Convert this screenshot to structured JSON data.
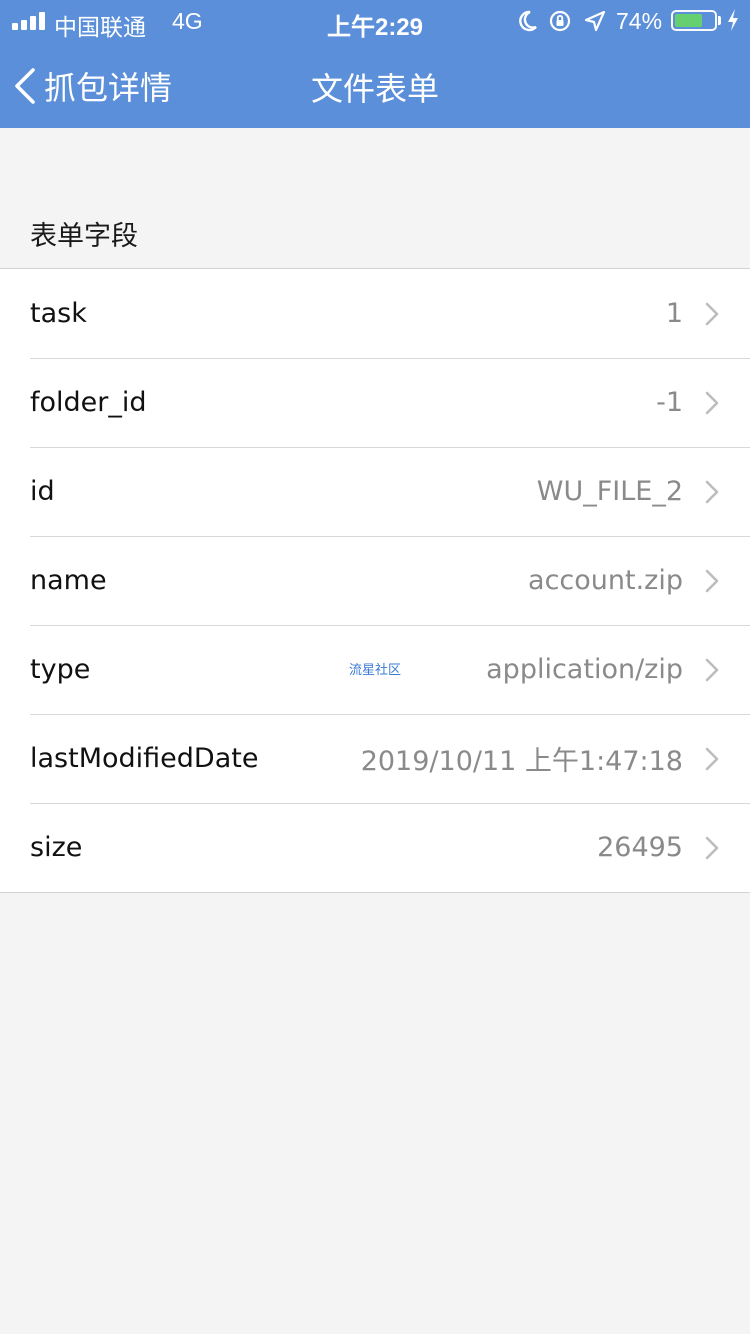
{
  "status_bar": {
    "carrier": "中国联通",
    "network": "4G",
    "time": "上午2:29",
    "battery_percent": "74%",
    "battery_level": 0.74,
    "icons": [
      "signal-icon",
      "moon-icon",
      "rotation-lock-icon",
      "location-icon",
      "battery-icon",
      "charging-icon"
    ]
  },
  "nav": {
    "back_label": "抓包详情",
    "title": "文件表单"
  },
  "section": {
    "title": "表单字段"
  },
  "fields": [
    {
      "key": "task",
      "value": "1"
    },
    {
      "key": "folder_id",
      "value": "-1"
    },
    {
      "key": "id",
      "value": "WU_FILE_2"
    },
    {
      "key": "name",
      "value": "account.zip"
    },
    {
      "key": "type",
      "value": "application/zip"
    },
    {
      "key": "lastModifiedDate",
      "value": "2019/10/11 上午1:47:18"
    },
    {
      "key": "size",
      "value": "26495"
    }
  ],
  "watermark": "流星社区",
  "colors": {
    "header": "#5b8fd9",
    "background": "#f4f4f4",
    "value_text": "#8a8a8a",
    "watermark": "#3a7bd5"
  }
}
